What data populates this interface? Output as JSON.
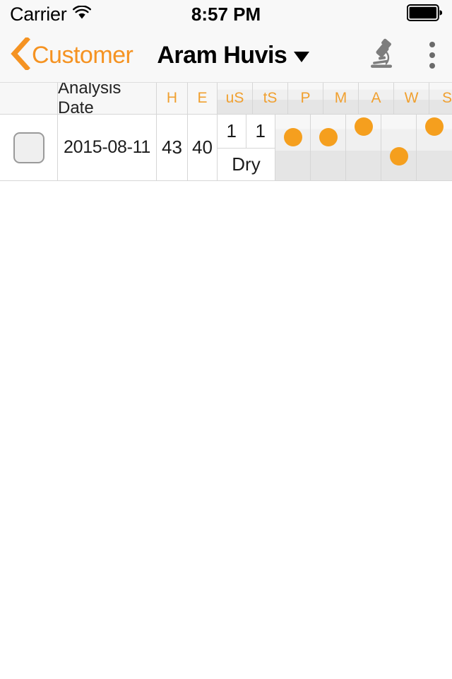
{
  "status_bar": {
    "carrier": "Carrier",
    "wifi_icon": "wifi-icon",
    "time": "8:57 PM",
    "battery_icon": "battery-full-icon"
  },
  "nav_bar": {
    "back_icon": "chevron-left-icon",
    "back_label": "Customer",
    "title": "Aram Huvis",
    "title_caret_icon": "chevron-down-icon",
    "microscope_icon": "microscope-icon",
    "overflow_icon": "more-vertical-icon",
    "accent_color": "#f59322",
    "title_color": "#000000"
  },
  "table": {
    "columns": [
      {
        "key": "check",
        "label": ""
      },
      {
        "key": "date",
        "label": "Analysis Date"
      },
      {
        "key": "H",
        "label": "H"
      },
      {
        "key": "E",
        "label": "E"
      },
      {
        "key": "uS",
        "label": "uS"
      },
      {
        "key": "tS",
        "label": "tS"
      },
      {
        "key": "P",
        "label": "P"
      },
      {
        "key": "M",
        "label": "M"
      },
      {
        "key": "A",
        "label": "A"
      },
      {
        "key": "W",
        "label": "W"
      },
      {
        "key": "S",
        "label": "S"
      }
    ],
    "header_accent_color": "#f0a030",
    "rows": [
      {
        "selected": false,
        "checkbox_icon": "checkbox-unchecked-icon",
        "date": "2015-08-11",
        "H": "43",
        "E": "40",
        "uS": "1",
        "tS": "1",
        "condition": "Dry",
        "dots": [
          {
            "column": "P",
            "level": 3
          },
          {
            "column": "M",
            "level": 3
          },
          {
            "column": "A",
            "level": 4
          },
          {
            "column": "W",
            "level": 1
          },
          {
            "column": "S",
            "level": 4
          }
        ],
        "dot_color": "#f59f1e"
      }
    ]
  }
}
